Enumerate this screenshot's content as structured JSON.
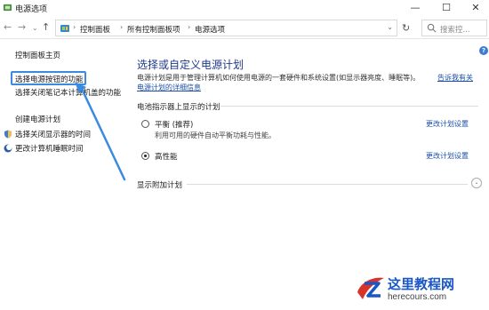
{
  "window": {
    "title": "电源选项",
    "icons": {
      "app": "power-options-icon",
      "minimize": "minimize-icon",
      "maximize": "maximize-icon",
      "close": "close-icon"
    }
  },
  "nav": {
    "back": "←",
    "forward": "→",
    "history": "⌄",
    "up": "↑",
    "refresh": "↻",
    "breadcrumbs": [
      "控制面板",
      "所有控制面板项",
      "电源选项"
    ],
    "search_placeholder": "搜索控..."
  },
  "help": "?",
  "sidebar": {
    "items": [
      {
        "label": "控制面板主页"
      },
      {
        "label": "选择电源按钮的功能",
        "highlighted": true
      },
      {
        "label": "选择关闭笔记本计算机盖的功能"
      },
      {
        "label": "创建电源计划"
      },
      {
        "label": "选择关闭显示器的时间",
        "icon": "shield-icon"
      },
      {
        "label": "更改计算机睡眠时间",
        "icon": "moon-icon"
      }
    ]
  },
  "main": {
    "title": "选择或自定义电源计划",
    "description": "电源计划是用于管理计算机如何使用电源的一套硬件和系统设置(如显示器亮度、睡眠等)。",
    "link_part1": "告诉我有关",
    "link_part2": "电源计划的详细信息",
    "section_label": "电池指示器上显示的计划",
    "plans": [
      {
        "name": "平衡 (推荐)",
        "description": "利用可用的硬件自动平衡功耗与性能。",
        "checked": false,
        "link": "更改计划设置"
      },
      {
        "name": "高性能",
        "description": "",
        "checked": true,
        "link": "更改计划设置"
      }
    ],
    "extra_plans_label": "显示附加计划",
    "expand": "⌄"
  },
  "watermark": {
    "title": "这里教程网",
    "url": "herecours.com"
  },
  "colors": {
    "accent_blue": "#1b4fa8",
    "highlight": "#3a8be0"
  }
}
